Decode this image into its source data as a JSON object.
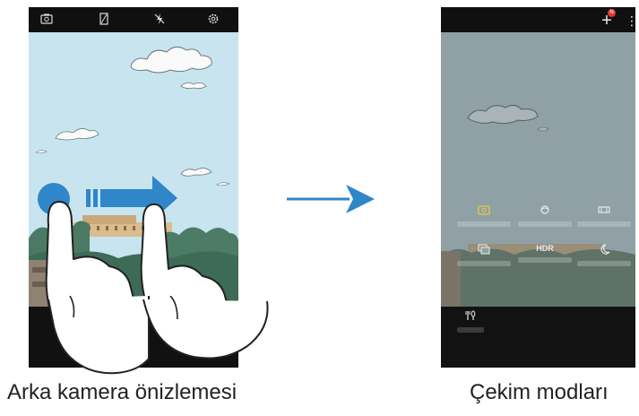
{
  "left_panel": {
    "caption": "Arka kamera önizlemesi",
    "top_icons": [
      "camera-switch-icon",
      "filter-icon",
      "flash-off-icon",
      "settings-icon"
    ]
  },
  "transition_arrow_color": "#2f86c9",
  "right_panel": {
    "caption": "Çekim modları",
    "badge_text": "N",
    "modes": [
      {
        "icon": "auto-camera-icon",
        "text": ""
      },
      {
        "icon": "panorama-cube-icon",
        "text": ""
      },
      {
        "icon": "panorama-icon",
        "text": ""
      },
      {
        "icon": "burst-icon",
        "text": ""
      },
      {
        "icon": "hdr-icon",
        "text": "HDR"
      },
      {
        "icon": "night-icon",
        "text": ""
      },
      {
        "icon": "food-icon",
        "text": ""
      }
    ]
  },
  "colors": {
    "sky": "#c8e4ef",
    "arrow": "#2f86c9",
    "badge": "#e03a2a",
    "dim_overlay": "#8fa1a4"
  }
}
